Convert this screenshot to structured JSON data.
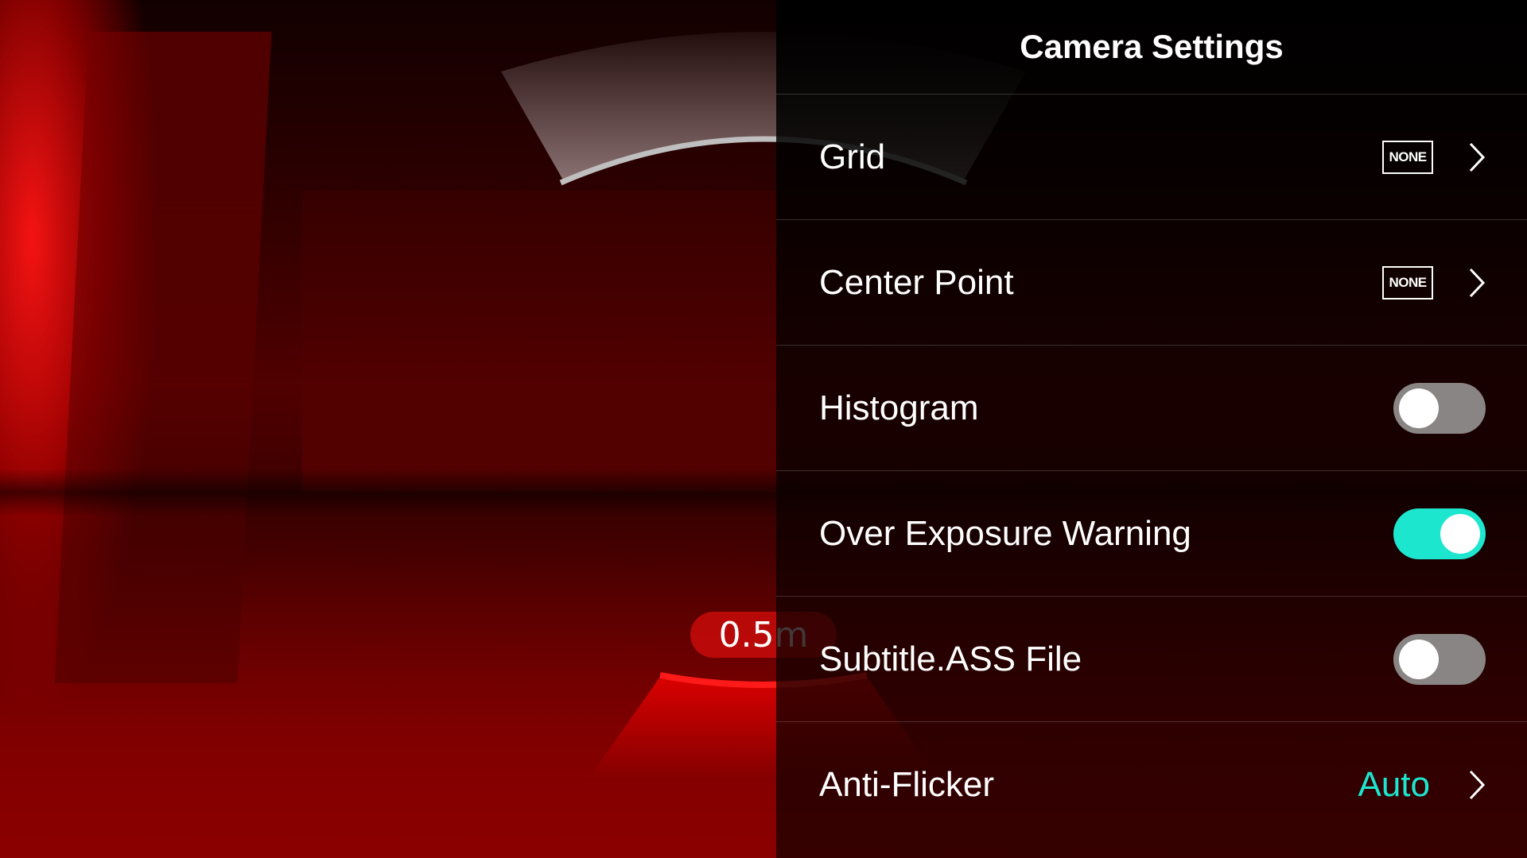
{
  "viewfinder": {
    "focus_distance_value": "0.5",
    "focus_distance_unit": "m"
  },
  "panel": {
    "title": "Camera Settings",
    "rows": [
      {
        "label": "Grid",
        "badge": "NONE"
      },
      {
        "label": "Center Point",
        "badge": "NONE"
      },
      {
        "label": "Histogram",
        "toggle": "off"
      },
      {
        "label": "Over Exposure Warning",
        "toggle": "on"
      },
      {
        "label": "Subtitle.ASS File",
        "toggle": "off"
      },
      {
        "label": "Anti-Flicker",
        "value": "Auto"
      }
    ]
  },
  "colors": {
    "accent": "#1de6cf",
    "toggle_off": "#8a8585",
    "focus_red": "#e00000"
  },
  "icons": [
    "chevron-right-icon"
  ]
}
